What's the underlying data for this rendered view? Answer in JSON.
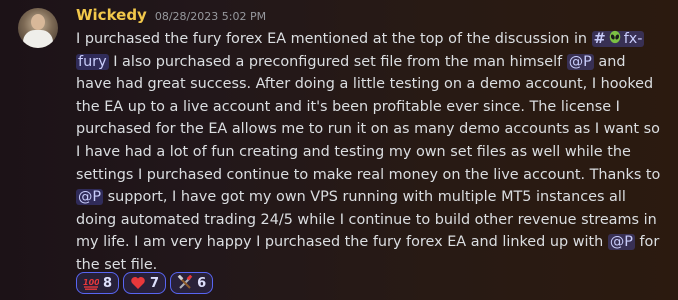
{
  "author": {
    "name": "Wickedy",
    "timestamp": "08/28/2023 5:02 PM",
    "name_color": "#f2c84b"
  },
  "message": {
    "lines": [
      [
        {
          "type": "text",
          "text": "I purchased the fury forex EA mentioned at the top of the discussion in "
        },
        {
          "type": "channel",
          "text": "fx-"
        }
      ],
      [
        {
          "type": "channel",
          "text": "fury"
        },
        {
          "type": "text",
          "text": " I also purchased a preconfigured set file from the man himself "
        },
        {
          "type": "mention",
          "text": "@P"
        },
        {
          "type": "text",
          "text": " and"
        }
      ],
      [
        {
          "type": "text",
          "text": "have had great success. After doing a little testing on a demo account, I hooked"
        }
      ],
      [
        {
          "type": "text",
          "text": "the EA up to a live account and it's been profitable ever since. The license I"
        }
      ],
      [
        {
          "type": "text",
          "text": "purchased for the EA allows me to run it on as many demo accounts as I want so"
        }
      ],
      [
        {
          "type": "text",
          "text": "I have had a lot of fun creating and testing my own set files as well while the"
        }
      ],
      [
        {
          "type": "text",
          "text": "settings I purchased continue to make real money on the live account. Thanks to"
        }
      ],
      [
        {
          "type": "mention",
          "text": "@P"
        },
        {
          "type": "text",
          "text": " support, I have got my own VPS running with multiple MT5 instances all"
        }
      ],
      [
        {
          "type": "text",
          "text": "doing automated trading 24/5 while I continue to build other revenue streams in"
        }
      ],
      [
        {
          "type": "text",
          "text": "my life. I am very happy I purchased the fury forex EA and linked up with "
        },
        {
          "type": "mention",
          "text": "@P"
        },
        {
          "type": "text",
          "text": " for"
        }
      ],
      [
        {
          "type": "text",
          "text": "the set file."
        }
      ]
    ],
    "channel_hash": "#"
  },
  "reactions": [
    {
      "emoji": "hundred-points-icon",
      "count": "8"
    },
    {
      "emoji": "red-heart-icon",
      "count": "7"
    },
    {
      "emoji": "crossed-tools-icon",
      "count": "6"
    }
  ],
  "colors": {
    "mention_bg": "#3a3f7a",
    "reaction_border": "#5865f2"
  }
}
